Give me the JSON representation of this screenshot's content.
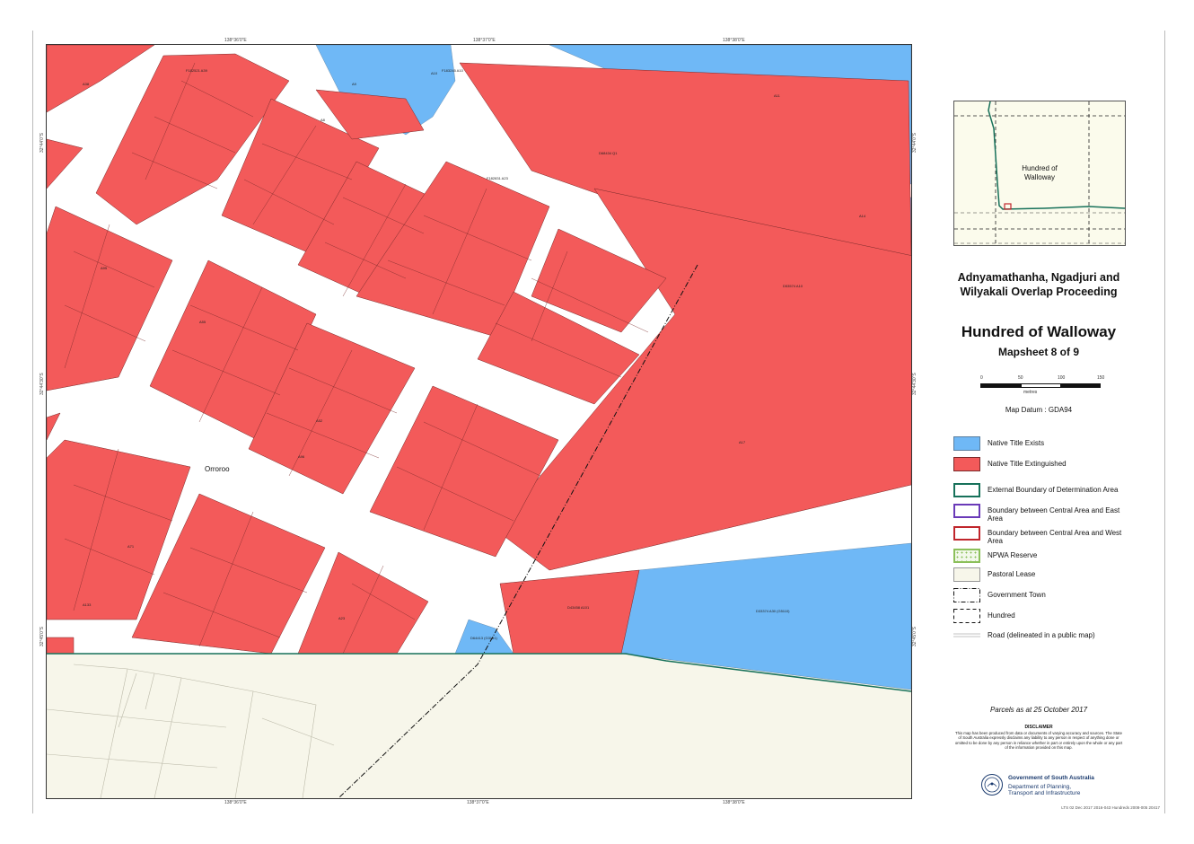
{
  "map": {
    "town_label": "Orroroo",
    "top_coords": [
      "138°36'0\"E",
      "138°37'0\"E",
      "138°38'0\"E"
    ],
    "bottom_coords": [
      "138°36'0\"E",
      "138°37'0\"E",
      "138°38'0\"E"
    ],
    "left_coords": [
      "32°44'0\"S",
      "32°44'30\"S",
      "32°45'0\"S"
    ],
    "right_coords": [
      "32°44'0\"S",
      "32°44'30\"S",
      "32°45'0\"S"
    ],
    "parcels": [
      {
        "label": "A38",
        "fill": "extinguished"
      },
      {
        "label": "F182521 A39",
        "fill": "extinguished"
      },
      {
        "label": "A8",
        "fill": "extinguished"
      },
      {
        "label": "F183245 A10",
        "fill": "extinguished"
      },
      {
        "label": "A55",
        "fill": "extinguished"
      },
      {
        "label": "A95",
        "fill": "extinguished"
      },
      {
        "label": "F182831 A23",
        "fill": "extinguished"
      },
      {
        "label": "A52",
        "fill": "extinguished"
      },
      {
        "label": "A96",
        "fill": "extinguished"
      },
      {
        "label": "A71",
        "fill": "extinguished"
      },
      {
        "label": "A133",
        "fill": "extinguished"
      },
      {
        "label": "A23",
        "fill": "extinguished"
      },
      {
        "label": "D68434 Q1",
        "fill": "extinguished"
      },
      {
        "label": "D43458 A101",
        "fill": "extinguished"
      },
      {
        "label": "D53574 A10",
        "fill": "extinguished"
      },
      {
        "label": "A9",
        "fill": "exists"
      },
      {
        "label": "A10",
        "fill": "exists"
      },
      {
        "label": "A11",
        "fill": "exists"
      },
      {
        "label": "A14",
        "fill": "exists"
      },
      {
        "label": "D64413 (G3181)",
        "fill": "exists"
      },
      {
        "label": "A17",
        "fill": "exists"
      },
      {
        "label": "D33374 A30 (G5110)",
        "fill": "exists"
      }
    ]
  },
  "inset": {
    "label_line1": "Hundred of",
    "label_line2": "Walloway"
  },
  "proceeding": {
    "line1": "Adnyamathanha, Ngadjuri and",
    "line2": "Wilyakali Overlap Proceeding"
  },
  "title": "Hundred of Walloway",
  "subtitle": "Mapsheet 8 of 9",
  "scale": {
    "ticks": [
      "0",
      "50",
      "100",
      "150"
    ],
    "unit": "metres"
  },
  "datum": "Map Datum : GDA94",
  "colors": {
    "native_title_exists": "#6fb8f6",
    "native_title_extinguished": "#f35a5a",
    "external_boundary": "#17715a",
    "boundary_central_east": "#6a3ab8",
    "boundary_central_west": "#c0262c",
    "npwa_reserve": "#8bbf5a",
    "pastoral_lease": "#f7f6ea",
    "road": "#ffffff"
  },
  "legend": [
    {
      "label": "Native Title Exists",
      "type": "fill-blue"
    },
    {
      "label": "Native Title Extinguished",
      "type": "fill-red"
    },
    {
      "label": "External Boundary of Determination Area",
      "type": "outline-green"
    },
    {
      "label": "Boundary between Central Area and East Area",
      "type": "outline-purple"
    },
    {
      "label": "Boundary between Central Area and West Area",
      "type": "outline-red"
    },
    {
      "label": "NPWA Reserve",
      "type": "npwa"
    },
    {
      "label": "Pastoral Lease",
      "type": "pastoral"
    },
    {
      "label": "Government Town",
      "type": "dashdot"
    },
    {
      "label": "Hundred",
      "type": "dashed"
    },
    {
      "label": "Road (delineated in a public map)",
      "type": "road"
    }
  ],
  "parcels_date": "Parcels as at 25 October 2017",
  "disclaimer": {
    "title": "DISCLAIMER",
    "text": "This map has been produced from data or documents of varying accuracy and sources. The State of South Australia expressly disclaims any liability to any person in respect of anything done or omitted to be done by any person in reliance whether in part or entirely upon the whole or any part of the information provided on this map."
  },
  "government": {
    "name": "Government of South Australia",
    "dept_line1": "Department of Planning,",
    "dept_line2": "Transport and Infrastructure"
  },
  "doc_ref": "LTS 02 Dec 2017 2016-043 Hundreds 2008-005 20417"
}
